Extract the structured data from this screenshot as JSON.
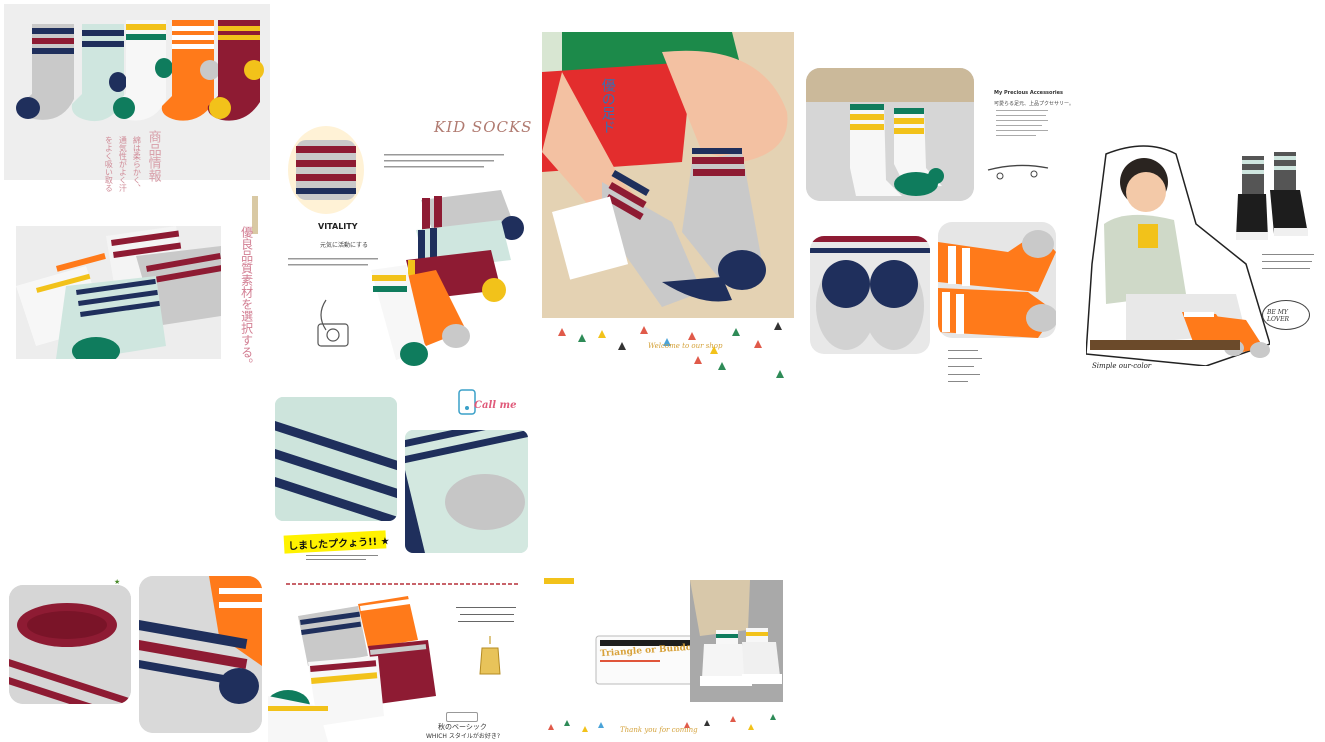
{
  "top_left": {
    "vertical_heading": "商品情報",
    "vertical_heading_2": "優良品質素材を選択する。",
    "vertical_body_1": "綿は柔らかく、",
    "vertical_body_2": "通気性がよく汗",
    "vertical_body_3": "をよく吸い取る"
  },
  "kid_socks": {
    "title": "KID SOCKS",
    "vitality": "VITALITY",
    "subtitle": "元気に活動にする"
  },
  "japanese_callouts": {
    "feet_title": "優の足ド",
    "mashita": "しましたプクょう!! ★",
    "call_me": "Call me",
    "welcome": "Welcome to our shop"
  },
  "accessories": {
    "heading": "My Precious Accessories",
    "subheading": "可愛らる足元、上品プクセサリー。"
  },
  "boy_section": {
    "simple_caption": "Simple our-color",
    "badge": "BE MY LOVER"
  },
  "bottom": {
    "triangle_banner": "Triangle or Bundo",
    "autumn_caption": "秋のベーシック",
    "which_style": "WHICH スタイルがお好き?",
    "thank_you": "Thank you for coming"
  },
  "colors": {
    "navy": "#1f2f5c",
    "maroon": "#8e1b33",
    "orange": "#ff7a1a",
    "grey": "#c9c9c9",
    "mint": "#cfe6df",
    "green": "#0f7c5d",
    "yellow": "#f2c21a",
    "white": "#f7f7f7"
  }
}
